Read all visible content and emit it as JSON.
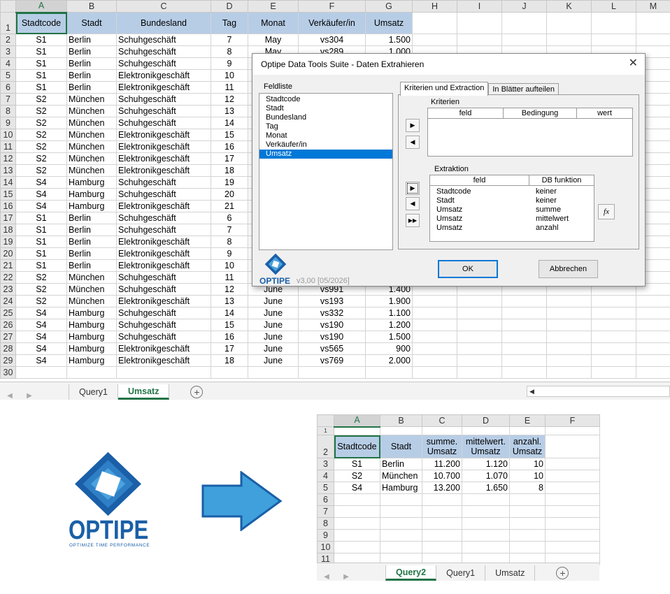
{
  "excel1": {
    "col_letters": [
      "A",
      "B",
      "C",
      "D",
      "E",
      "F",
      "G",
      "H",
      "I",
      "J",
      "K",
      "L",
      "M"
    ],
    "headers": [
      "Stadtcode",
      "Stadt",
      "Bundesland",
      "Tag",
      "Monat",
      "Verkäufer/in",
      "Umsatz"
    ],
    "rows": [
      [
        "2",
        "S1",
        "Berlin",
        "Schuhgeschäft",
        "7",
        "May",
        "vs304",
        "1.500"
      ],
      [
        "3",
        "S1",
        "Berlin",
        "Schuhgeschäft",
        "8",
        "May",
        "vs289",
        "1.000"
      ],
      [
        "4",
        "S1",
        "Berlin",
        "Schuhgeschäft",
        "9",
        "",
        "",
        ""
      ],
      [
        "5",
        "S1",
        "Berlin",
        "Elektronikgeschäft",
        "10",
        "",
        "",
        ""
      ],
      [
        "6",
        "S1",
        "Berlin",
        "Elektronikgeschäft",
        "11",
        "",
        "",
        ""
      ],
      [
        "7",
        "S2",
        "München",
        "Schuhgeschäft",
        "12",
        "",
        "",
        ""
      ],
      [
        "8",
        "S2",
        "München",
        "Schuhgeschäft",
        "13",
        "",
        "",
        ""
      ],
      [
        "9",
        "S2",
        "München",
        "Schuhgeschäft",
        "14",
        "",
        "",
        ""
      ],
      [
        "10",
        "S2",
        "München",
        "Elektronikgeschäft",
        "15",
        "",
        "",
        ""
      ],
      [
        "11",
        "S2",
        "München",
        "Elektronikgeschäft",
        "16",
        "",
        "",
        ""
      ],
      [
        "12",
        "S2",
        "München",
        "Elektronikgeschäft",
        "17",
        "",
        "",
        ""
      ],
      [
        "13",
        "S2",
        "München",
        "Elektronikgeschäft",
        "18",
        "",
        "",
        ""
      ],
      [
        "14",
        "S4",
        "Hamburg",
        "Schuhgeschäft",
        "19",
        "",
        "",
        ""
      ],
      [
        "15",
        "S4",
        "Hamburg",
        "Schuhgeschäft",
        "20",
        "",
        "",
        ""
      ],
      [
        "16",
        "S4",
        "Hamburg",
        "Elektronikgeschäft",
        "21",
        "",
        "",
        ""
      ],
      [
        "17",
        "S1",
        "Berlin",
        "Schuhgeschäft",
        "6",
        "",
        "",
        ""
      ],
      [
        "18",
        "S1",
        "Berlin",
        "Schuhgeschäft",
        "7",
        "",
        "",
        ""
      ],
      [
        "19",
        "S1",
        "Berlin",
        "Elektronikgeschäft",
        "8",
        "",
        "",
        ""
      ],
      [
        "20",
        "S1",
        "Berlin",
        "Elektronikgeschäft",
        "9",
        "",
        "",
        ""
      ],
      [
        "21",
        "S1",
        "Berlin",
        "Elektronikgeschäft",
        "10",
        "",
        "",
        ""
      ],
      [
        "22",
        "S2",
        "München",
        "Schuhgeschäft",
        "11",
        "",
        "",
        ""
      ],
      [
        "23",
        "S2",
        "München",
        "Schuhgeschäft",
        "12",
        "June",
        "vs991",
        "1.400"
      ],
      [
        "24",
        "S2",
        "München",
        "Elektronikgeschäft",
        "13",
        "June",
        "vs193",
        "1.900"
      ],
      [
        "25",
        "S4",
        "Hamburg",
        "Schuhgeschäft",
        "14",
        "June",
        "vs332",
        "1.100"
      ],
      [
        "26",
        "S4",
        "Hamburg",
        "Schuhgeschäft",
        "15",
        "June",
        "vs190",
        "1.200"
      ],
      [
        "27",
        "S4",
        "Hamburg",
        "Schuhgeschäft",
        "16",
        "June",
        "vs190",
        "1.500"
      ],
      [
        "28",
        "S4",
        "Hamburg",
        "Elektronikgeschäft",
        "17",
        "June",
        "vs565",
        "900"
      ],
      [
        "29",
        "S4",
        "Hamburg",
        "Elektronikgeschäft",
        "18",
        "June",
        "vs769",
        "2.000"
      ],
      [
        "30",
        "",
        "",
        "",
        "",
        "",
        "",
        ""
      ]
    ],
    "tabs": [
      "Query1",
      "Umsatz"
    ],
    "active_tab": "Umsatz"
  },
  "dialog": {
    "title": "Optipe Data Tools Suite - Daten Extrahieren",
    "close_glyph": "✕",
    "feldliste_label": "Feldliste",
    "fields": [
      "Stadtcode",
      "Stadt",
      "Bundesland",
      "Tag",
      "Monat",
      "Verkäufer/in",
      "Umsatz"
    ],
    "selected_field": "Umsatz",
    "tabs": [
      "Kriterien und Extraction",
      "In Blätter aufteilen"
    ],
    "kriterien_label": "Kriterien",
    "kriterien_cols": [
      "feld",
      "Bedingung",
      "wert"
    ],
    "extraktion_label": "Extraktion",
    "extraktion_cols": [
      "feld",
      "DB funktion"
    ],
    "extraktion_rows": [
      [
        "Stadtcode",
        "keiner"
      ],
      [
        "Stadt",
        "keiner"
      ],
      [
        "Umsatz",
        "summe"
      ],
      [
        "Umsatz",
        "mittelwert"
      ],
      [
        "Umsatz",
        "anzahl"
      ]
    ],
    "btn_right": "▶",
    "btn_left": "◀",
    "btn_all": "▶▶",
    "fx_label": "fx",
    "brand": "OPTIPE",
    "version": "v3,00 [05/2026]",
    "ok_label": "OK",
    "cancel_label": "Abbrechen"
  },
  "logo": {
    "brand": "OPTIPE",
    "tagline": "OPTIMIZE TIME PERFORMANCE",
    "primary_color": "#1a5fa8",
    "light_color": "#4aa3de"
  },
  "arrow_color": "#3fa0dc",
  "excel2": {
    "col_letters": [
      "A",
      "B",
      "C",
      "D",
      "E",
      "F"
    ],
    "headers": [
      [
        "Stadtcode",
        ""
      ],
      [
        "Stadt",
        ""
      ],
      [
        "summe.",
        "Umsatz"
      ],
      [
        "mittelwert.",
        "Umsatz"
      ],
      [
        "anzahl.",
        "Umsatz"
      ]
    ],
    "rows": [
      [
        "3",
        "S1",
        "Berlin",
        "11.200",
        "1.120",
        "10"
      ],
      [
        "4",
        "S2",
        "München",
        "10.700",
        "1.070",
        "10"
      ],
      [
        "5",
        "S4",
        "Hamburg",
        "13.200",
        "1.650",
        "8"
      ],
      [
        "6",
        "",
        "",
        "",
        "",
        ""
      ],
      [
        "7",
        "",
        "",
        "",
        "",
        ""
      ],
      [
        "8",
        "",
        "",
        "",
        "",
        ""
      ],
      [
        "9",
        "",
        "",
        "",
        "",
        ""
      ],
      [
        "10",
        "",
        "",
        "",
        "",
        ""
      ],
      [
        "11",
        "",
        "",
        "",
        "",
        ""
      ]
    ],
    "tabs": [
      "Query2",
      "Query1",
      "Umsatz"
    ],
    "active_tab": "Query2"
  }
}
